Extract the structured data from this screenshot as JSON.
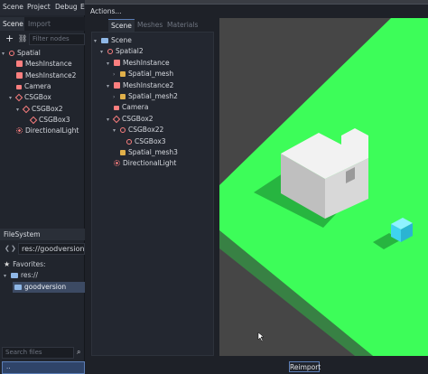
{
  "menubar": [
    "Scene",
    "Project",
    "Debug",
    "E"
  ],
  "dock_tabs": {
    "scene": "Scene",
    "import": "Import"
  },
  "toolbar": {
    "add": "+",
    "link": "⛓",
    "filter_placeholder": "Filter nodes"
  },
  "scene_tree": [
    {
      "label": "Spatial",
      "icon": "spatial-icon",
      "indent": 0,
      "arrow": "▾"
    },
    {
      "label": "MeshInstance",
      "icon": "mesh-icon",
      "indent": 1,
      "arrow": ""
    },
    {
      "label": "MeshInstance2",
      "icon": "mesh-icon",
      "indent": 1,
      "arrow": ""
    },
    {
      "label": "Camera",
      "icon": "camera-icon",
      "indent": 1,
      "arrow": ""
    },
    {
      "label": "CSGBox",
      "icon": "csg-icon",
      "indent": 1,
      "arrow": "▾"
    },
    {
      "label": "CSGBox2",
      "icon": "csg-icon",
      "indent": 2,
      "arrow": "▾"
    },
    {
      "label": "CSGBox3",
      "icon": "csg-icon",
      "indent": 3,
      "arrow": ""
    },
    {
      "label": "DirectionalLight",
      "icon": "light-icon",
      "indent": 1,
      "arrow": ""
    }
  ],
  "filesystem": {
    "header": "FileSystem",
    "nav_back": "❮",
    "nav_forward": "❯",
    "path": "res://goodversion/Sp",
    "favorites_label": "Favorites:",
    "root": "res://",
    "folder": "goodversion",
    "search_placeholder": "Search files",
    "bottom_item": ".."
  },
  "dialog": {
    "actions": "Actions...",
    "tabs": {
      "scene": "Scene",
      "meshes": "Meshes",
      "materials": "Materials"
    },
    "tree": [
      {
        "label": "Scene",
        "icon": "folder-icon",
        "indent": 0,
        "arrow": "▾"
      },
      {
        "label": "Spatial2",
        "icon": "spatial-icon",
        "indent": 1,
        "arrow": "▾"
      },
      {
        "label": "MeshInstance",
        "icon": "mesh-icon",
        "indent": 2,
        "arrow": "▾"
      },
      {
        "label": "Spatial_mesh",
        "icon": "import-icon",
        "indent": 3,
        "arrow": "›"
      },
      {
        "label": "MeshInstance2",
        "icon": "mesh-icon",
        "indent": 2,
        "arrow": "▾"
      },
      {
        "label": "Spatial_mesh2",
        "icon": "import-icon",
        "indent": 3,
        "arrow": "›"
      },
      {
        "label": "Camera",
        "icon": "camera-icon",
        "indent": 2,
        "arrow": ""
      },
      {
        "label": "CSGBox2",
        "icon": "csg-icon",
        "indent": 2,
        "arrow": "▾"
      },
      {
        "label": "CSGBox22",
        "icon": "spatial-icon",
        "indent": 3,
        "arrow": "▾"
      },
      {
        "label": "CSGBox3",
        "icon": "spatial-icon",
        "indent": 4,
        "arrow": ""
      },
      {
        "label": "Spatial_mesh3",
        "icon": "import-icon",
        "indent": 3,
        "arrow": ""
      },
      {
        "label": "DirectionalLight",
        "icon": "light-icon",
        "indent": 2,
        "arrow": ""
      }
    ],
    "reimport": "Reimport"
  },
  "colors": {
    "ground": "#3dfd59",
    "box": "#d8d8d8",
    "cube": "#3fd3ee",
    "accent": "#5b7db5"
  }
}
